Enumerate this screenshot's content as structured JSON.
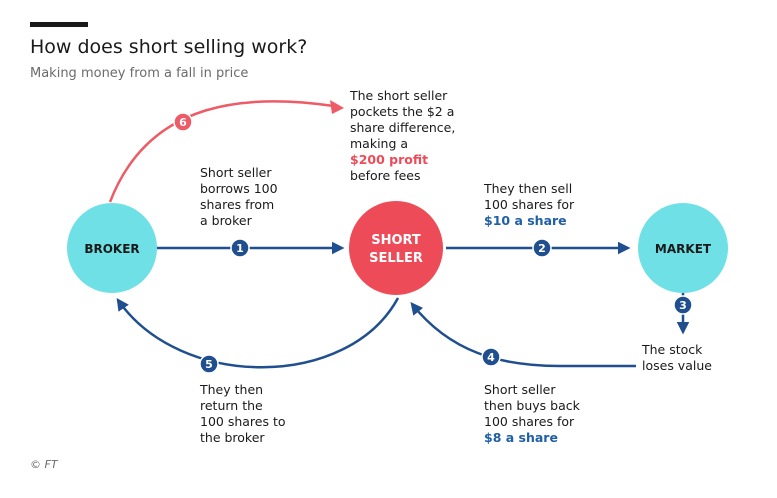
{
  "header": {
    "title": "How does short selling work?",
    "subtitle": "Making money from a fall in price"
  },
  "credit": "© FT",
  "colors": {
    "arrow_blue": "#1f4f8f",
    "arrow_red": "#ee5a65",
    "node_cyan": "#6fe1e6",
    "node_red": "#ee4b58",
    "highlight_blue": "#1f5fa8",
    "highlight_red": "#ee4b58"
  },
  "nodes": {
    "broker": "BROKER",
    "short_seller_line1": "SHORT",
    "short_seller_line2": "SELLER",
    "market": "MARKET"
  },
  "steps": {
    "s1": "1",
    "s2": "2",
    "s3": "3",
    "s4": "4",
    "s5": "5",
    "s6": "6"
  },
  "notes": {
    "borrow": [
      "Short seller",
      "borrows 100",
      "shares from",
      "a broker"
    ],
    "sell": [
      "They then sell",
      "100 shares for"
    ],
    "sell_price": "$10 a share",
    "value": [
      "The stock",
      "loses value"
    ],
    "buyback": [
      "Short seller",
      "then buys back",
      "100 shares for"
    ],
    "buyback_price": "$8 a share",
    "return": [
      "They then",
      "return the",
      "100 shares to",
      "the broker"
    ],
    "profit_intro": [
      "The short seller",
      "pockets the $2 a",
      "share difference,",
      "making a"
    ],
    "profit_amount": "$200 profit",
    "profit_outro": "before fees"
  }
}
